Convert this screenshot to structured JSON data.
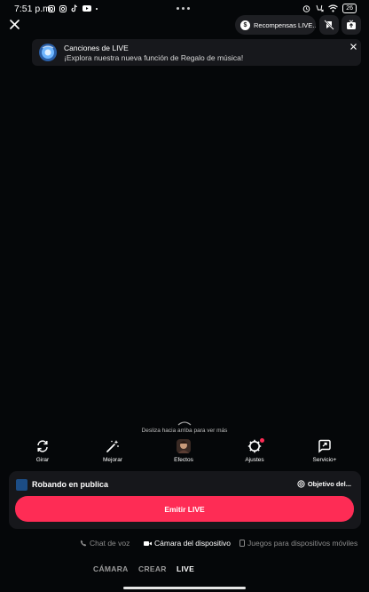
{
  "status_bar": {
    "time": "7:51 p.m.",
    "battery": "26"
  },
  "top_bar": {
    "rewards_label": "Recompensas LIVE..."
  },
  "banner": {
    "title": "Canciones de LIVE",
    "subtitle": "¡Explora nuestra nueva función de Regalo de música!"
  },
  "swipe_hint": "Desliza hacia arriba para ver más",
  "tools": [
    {
      "label": "Girar",
      "icon": "rotate-icon"
    },
    {
      "label": "Mejorar",
      "icon": "magic-wand-icon"
    },
    {
      "label": "Efectos",
      "icon": "effects-icon"
    },
    {
      "label": "Ajustes",
      "icon": "gear-icon"
    },
    {
      "label": "Servicio+",
      "icon": "service-icon"
    }
  ],
  "panel": {
    "stream_title": "Robando en publica",
    "goal_label": "Objetivo del...",
    "go_live_label": "Emitir LIVE"
  },
  "modes": [
    {
      "label": "Chat de voz",
      "icon": "phone-icon",
      "active": false
    },
    {
      "label": "Cámara del dispositivo",
      "icon": "camera-icon",
      "active": true
    },
    {
      "label": "Juegos para dispositivos móviles",
      "icon": "mobile-icon",
      "active": false
    }
  ],
  "tabs": [
    {
      "label": "CÁMARA",
      "active": false
    },
    {
      "label": "CREAR",
      "active": false
    },
    {
      "label": "LIVE",
      "active": true
    }
  ],
  "colors": {
    "background": "#050709",
    "accent": "#fe2c55",
    "panel": "#16171b"
  }
}
